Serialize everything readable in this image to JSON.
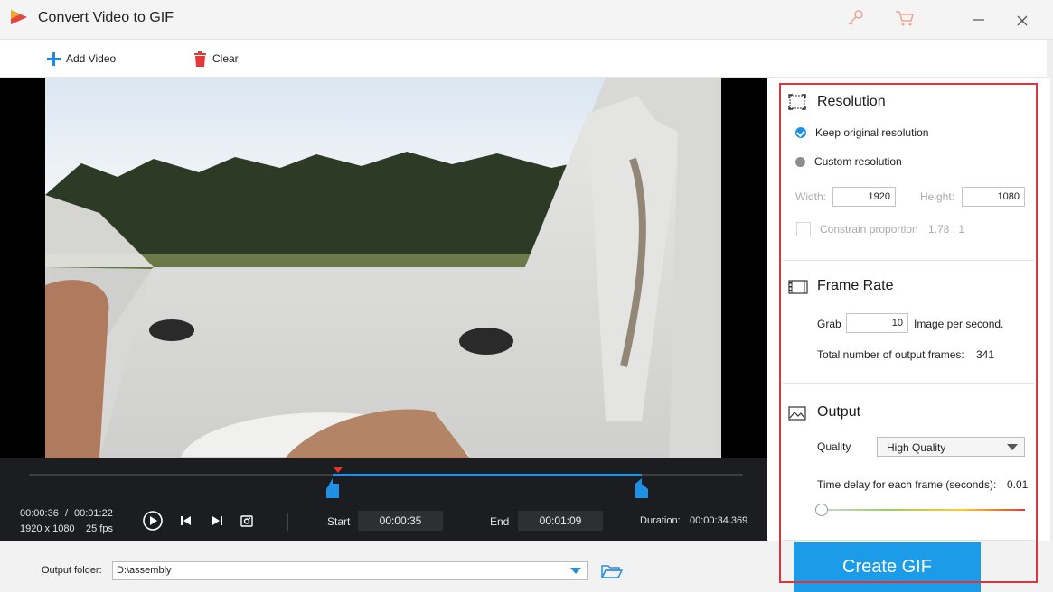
{
  "app": {
    "title": "Convert Video to GIF"
  },
  "toolbar": {
    "add_video": "Add Video",
    "clear": "Clear"
  },
  "timeline": {
    "current_time": "00:00:36",
    "separator": "/",
    "total_time": "00:01:22",
    "resolution": "1920 x 1080",
    "fps": "25 fps",
    "start_label": "Start",
    "start_value": "00:00:35",
    "end_label": "End",
    "end_value": "00:01:09",
    "duration_label": "Duration:",
    "duration_value": "00:00:34.369"
  },
  "resolution": {
    "title": "Resolution",
    "keep_original": "Keep original resolution",
    "custom": "Custom resolution",
    "width_label": "Width:",
    "width_value": "1920",
    "height_label": "Height:",
    "height_value": "1080",
    "constrain_label": "Constrain proportion",
    "constrain_ratio": "1.78 : 1"
  },
  "frame_rate": {
    "title": "Frame Rate",
    "grab_label": "Grab",
    "grab_value": "10",
    "per_second": "Image per second.",
    "total_frames_label": "Total number of output frames:",
    "total_frames_value": "341"
  },
  "output": {
    "title": "Output",
    "quality_label": "Quality",
    "quality_value": "High Quality",
    "delay_label": "Time delay for each frame (seconds):",
    "delay_value": "0.01"
  },
  "output_folder": {
    "label": "Output folder:",
    "value": "D:\\assembly"
  },
  "create_button": "Create GIF",
  "colors": {
    "accent": "#1c9be8",
    "highlight_frame": "#d9363e"
  }
}
